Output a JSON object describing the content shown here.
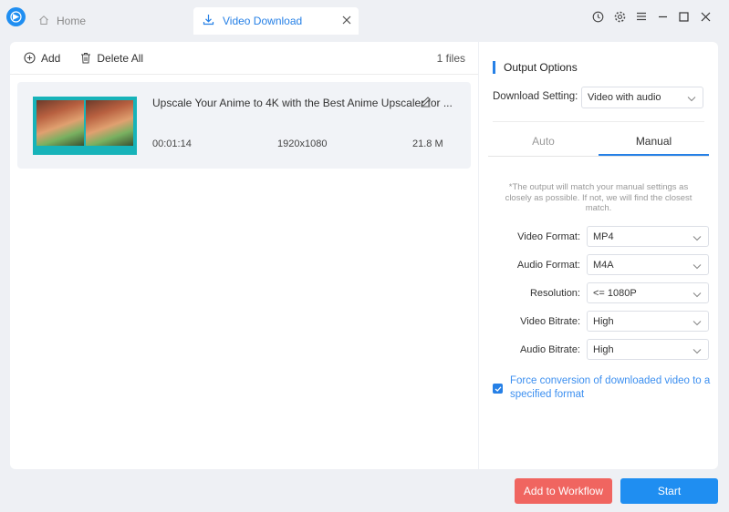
{
  "colors": {
    "accent": "#2680e6",
    "workflow_button": "#f06560",
    "start_button": "#1f8ef1",
    "background": "#eef0f4"
  },
  "titlebar": {
    "logo_icon": "app-logo-icon",
    "tabs": [
      {
        "label": "Home",
        "icon": "home-icon"
      },
      {
        "label": "Video Download",
        "icon": "download-icon"
      }
    ],
    "controls": [
      "history-icon",
      "settings-icon",
      "menu-icon",
      "minimize-icon",
      "maximize-icon",
      "close-icon"
    ]
  },
  "toolbar": {
    "add_label": "Add",
    "delete_all_label": "Delete All",
    "files_count": "1 files"
  },
  "file": {
    "title": "Upscale Your Anime to 4K with the Best Anime Upscaler for ...",
    "duration": "00:01:14",
    "resolution": "1920x1080",
    "size": "21.8 M"
  },
  "output_options": {
    "header": "Output Options",
    "download_setting_label": "Download Setting:",
    "download_setting_value": "Video with audio",
    "tabs": [
      "Auto",
      "Manual"
    ],
    "active_tab": "Manual",
    "note": "*The output will match your manual settings as closely as possible. If not, we will find the closest match.",
    "fields": [
      {
        "label": "Video Format:",
        "value": "MP4"
      },
      {
        "label": "Audio Format:",
        "value": "M4A"
      },
      {
        "label": "Resolution:",
        "value": "<= 1080P"
      },
      {
        "label": "Video Bitrate:",
        "value": "High"
      },
      {
        "label": "Audio Bitrate:",
        "value": "High"
      }
    ],
    "force_conversion_label": "Force conversion of downloaded video to a specified format",
    "force_conversion_checked": true
  },
  "buttons": {
    "add_to_workflow": "Add to Workflow",
    "start": "Start"
  }
}
